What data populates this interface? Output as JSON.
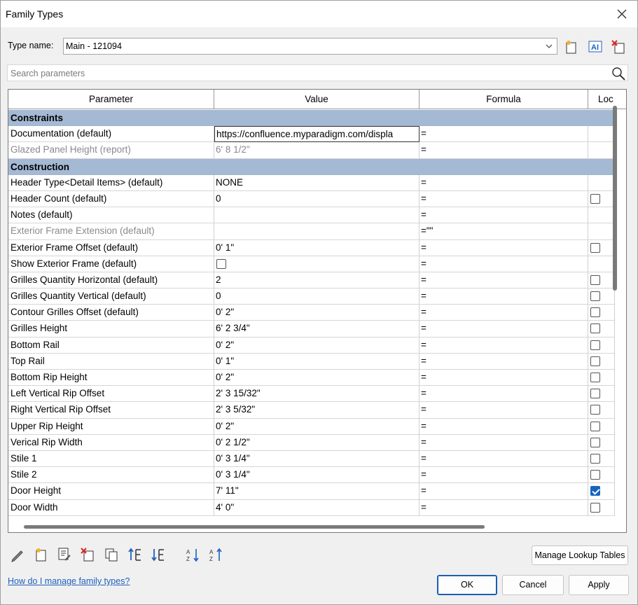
{
  "window": {
    "title": "Family Types"
  },
  "type_name": {
    "label": "Type name:",
    "value": "Main - 121094"
  },
  "search": {
    "placeholder": "Search parameters"
  },
  "columns": {
    "parameter": "Parameter",
    "value": "Value",
    "formula": "Formula",
    "lock": "Loc"
  },
  "rows": [
    {
      "kind": "group",
      "label": "Constraints"
    },
    {
      "kind": "param",
      "name": "Documentation (default)",
      "value": "https://confluence.myparadigm.com/displa",
      "formula": "=",
      "lock": "none",
      "editing": true
    },
    {
      "kind": "param",
      "name": "Glazed Panel Height (report)",
      "value": "6'  8 1/2\"",
      "formula": "=",
      "lock": "none",
      "dim": true
    },
    {
      "kind": "group",
      "label": "Construction"
    },
    {
      "kind": "param",
      "name": "Header Type<Detail Items> (default)",
      "value": "NONE",
      "formula": "=",
      "lock": "none"
    },
    {
      "kind": "param",
      "name": "Header Count (default)",
      "value": "0",
      "formula": "=",
      "lock": "unchecked"
    },
    {
      "kind": "param",
      "name": "Notes (default)",
      "value": "",
      "formula": "=",
      "lock": "none"
    },
    {
      "kind": "param",
      "name": "Exterior Frame Extension (default)",
      "value": "",
      "formula": "=\"\"",
      "lock": "none",
      "dim": true
    },
    {
      "kind": "param",
      "name": "Exterior Frame Offset (default)",
      "value": "0'  1\"",
      "formula": "=",
      "lock": "unchecked"
    },
    {
      "kind": "param",
      "name": "Show Exterior Frame (default)",
      "value": "",
      "value_checkbox": true,
      "formula": "=",
      "lock": "none"
    },
    {
      "kind": "param",
      "name": "Grilles Quantity Horizontal (default)",
      "value": "2",
      "formula": "=",
      "lock": "unchecked"
    },
    {
      "kind": "param",
      "name": "Grilles Quantity Vertical (default)",
      "value": "0",
      "formula": "=",
      "lock": "unchecked"
    },
    {
      "kind": "param",
      "name": "Contour Grilles Offset (default)",
      "value": "0'  2\"",
      "formula": "=",
      "lock": "unchecked"
    },
    {
      "kind": "param",
      "name": "Grilles Height",
      "value": "6'  2 3/4\"",
      "formula": "=",
      "lock": "unchecked"
    },
    {
      "kind": "param",
      "name": "Bottom Rail",
      "value": "0'  2\"",
      "formula": "=",
      "lock": "unchecked"
    },
    {
      "kind": "param",
      "name": "Top Rail",
      "value": "0'  1\"",
      "formula": "=",
      "lock": "unchecked"
    },
    {
      "kind": "param",
      "name": "Bottom Rip Height",
      "value": "0'  2\"",
      "formula": "=",
      "lock": "unchecked"
    },
    {
      "kind": "param",
      "name": "Left Vertical Rip Offset",
      "value": "2'  3 15/32\"",
      "formula": "=",
      "lock": "unchecked"
    },
    {
      "kind": "param",
      "name": "Right Vertical Rip Offset",
      "value": "2'  3 5/32\"",
      "formula": "=",
      "lock": "unchecked"
    },
    {
      "kind": "param",
      "name": "Upper Rip Height",
      "value": "0'  2\"",
      "formula": "=",
      "lock": "unchecked"
    },
    {
      "kind": "param",
      "name": "Verical Rip Width",
      "value": "0'  2 1/2\"",
      "formula": "=",
      "lock": "unchecked"
    },
    {
      "kind": "param",
      "name": "Stile 1",
      "value": "0'  3 1/4\"",
      "formula": "=",
      "lock": "unchecked"
    },
    {
      "kind": "param",
      "name": "Stile 2",
      "value": "0'  3 1/4\"",
      "formula": "=",
      "lock": "unchecked"
    },
    {
      "kind": "param",
      "name": "Door Height",
      "value": "7'  11\"",
      "formula": "=",
      "lock": "checked"
    },
    {
      "kind": "param",
      "name": "Door Width",
      "value": "4'  0\"",
      "formula": "=",
      "lock": "unchecked"
    }
  ],
  "buttons": {
    "manage_lookup": "Manage Lookup Tables",
    "ok": "OK",
    "cancel": "Cancel",
    "apply": "Apply"
  },
  "help_link": "How do I manage family types?",
  "colors": {
    "group_header": "#a4b9d3",
    "accent": "#1565c0"
  },
  "toolbar_icons": [
    "new-type-icon",
    "rename-type-icon",
    "delete-type-icon"
  ],
  "bottom_icons": [
    "edit-parameter-icon",
    "new-parameter-icon",
    "modify-parameter-icon",
    "delete-parameter-icon",
    "copy-parameter-icon",
    "move-up-icon",
    "move-down-icon",
    "sort-ascending-icon",
    "sort-descending-icon"
  ]
}
